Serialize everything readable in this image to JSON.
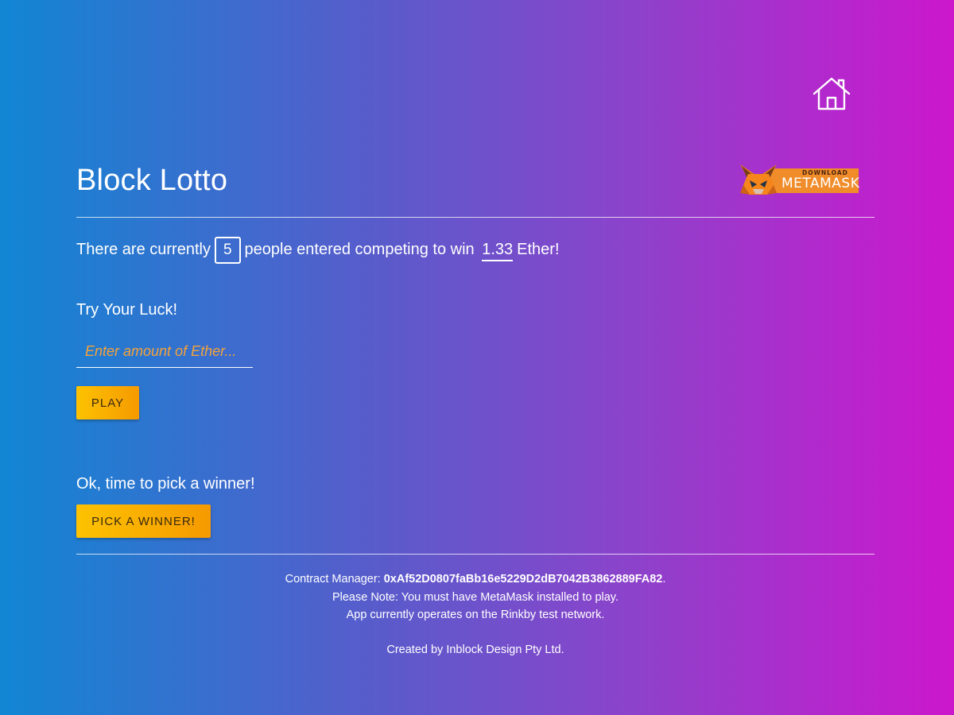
{
  "nav": {
    "home_icon": "home-icon"
  },
  "header": {
    "title": "Block Lotto",
    "metamask_badge": {
      "small_text": "DOWNLOAD",
      "big_text": "METAMASK",
      "icon": "metamask-fox-icon",
      "color": "#f08c2a"
    }
  },
  "status": {
    "prefix": "There are currently",
    "player_count": "5",
    "middle": "people entered competing to win",
    "prize": "1.33",
    "suffix": "Ether!"
  },
  "entry": {
    "label": "Try Your Luck!",
    "input_placeholder": "Enter amount of Ether...",
    "input_value": "",
    "play_button": "PLAY"
  },
  "winner": {
    "label": "Ok, time to pick a winner!",
    "button": "PICK A WINNER!"
  },
  "footer": {
    "manager_prefix": "Contract Manager: ",
    "manager_address": "0xAf52D0807faBb16e5229D2dB7042B3862889FA82",
    "manager_suffix": ".",
    "note_prefix": "Please Note: You must have ",
    "note_link": "MetaMask",
    "note_suffix": " installed to play.",
    "network_note": "App currently operates on the Rinkby test network.",
    "credit": "Created by Inblock Design Pty Ltd."
  },
  "colors": {
    "gradient_start": "#1186d3",
    "gradient_end": "#cc17cc",
    "button_start": "#fdc200",
    "button_end": "#f59a00",
    "placeholder": "#f3a23a"
  }
}
